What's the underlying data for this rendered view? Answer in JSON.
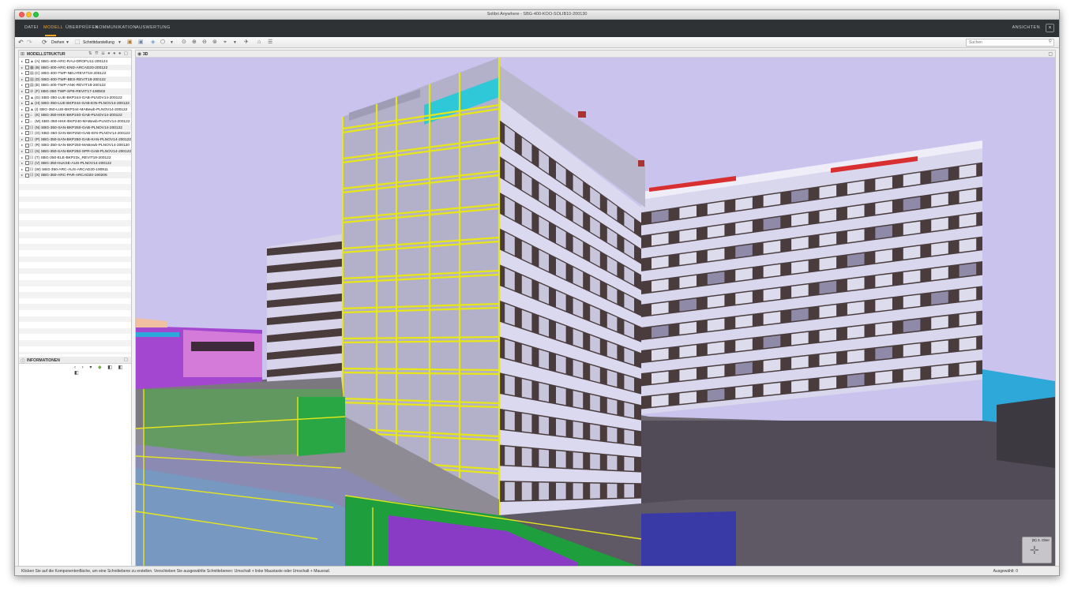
{
  "window": {
    "title": "Solibri Anywhere - SBG-400-KOO-SOLIB10-200130"
  },
  "menu": {
    "items": [
      "DATEI",
      "MODELL",
      "ÜBERPRÜFEN",
      "KOMMUNIKATION",
      "AUSWERTUNG"
    ],
    "active": "MODELL",
    "right": "ANSICHTEN"
  },
  "toolbar": {
    "rotate_label": "Drehen",
    "section_label": "Schnittdarstellung",
    "search_placeholder": "Suchen"
  },
  "model_tree": {
    "title": "MODELLSTRUKTUR",
    "items": [
      "(A) SBG-400-ARC-RAU-DROFU11-200124",
      "(B) SBG-400-ARC-END-ARCAD20-200122",
      "(C) SBG-400-TWP-NEU-REVIT18-200122",
      "(D) SBG-400-TWP-BES-REVIT18-200122",
      "(E) SBG-400-TWP-ANK-REVIT18-200122",
      "(F) SBG-350-TWP-SPE-REVIT17-190502",
      "(G) SBG-350-LUE-BKP244-GAB-PLNOV14-200122",
      "(H) SBG-350-LUE-BKP244-GAB-EIN-PLNOV14-200122",
      "(I) SBG-350-LUE-BKP244-MABewb-PLNOV14-200122",
      "(K) SBG-350-HKK-BKP240-GAB-PLNOV14-200122",
      "(M) SBG-350-HKK-BKP240-MABewb-PLNOV14-200122",
      "(N) SBG-350-SAN-BKP250-GAB-PLNOV14-200122",
      "(O) SBG-350-SAN-BKP250-GAB-EIN-PLNOV14-200122",
      "(P) SBG-350-SAN-BKP250-GAB-KAN-PLNOV14-200122",
      "(R) SBG-350-SAN-BKP250-MABewb-PLNOV14-200120",
      "(S) SBG-350-SAN-BKP250-SPR-GAB-PLNOV14-200122",
      "(T) SBG-350-ELE-BKP23x_REVIT19-200122",
      "(V) SBG-350-HLKSE-AUS-PLNOV14-200122",
      "(W) SBG-350-ARC-AUS-ARCAD20-190911",
      "(X) SBG-350-ARC-PAR-ARCAD20-190206"
    ]
  },
  "info_panel": {
    "title": "INFORMATIONEN"
  },
  "view3d": {
    "title": "3D",
    "navcube_label": "(B) 3. Ober"
  },
  "status": {
    "message": "Klicken Sie auf die Komponentenfläche, um eine Schnittebene zu erstellen. Verschieben Sie ausgewählte Schnittebenen: Umschalt + linke Maustaste oder Umschalt + Mausrad.",
    "selected": "Ausgewählt: 0"
  },
  "colors": {
    "menubar": "#2e3235",
    "accent": "#f5a623",
    "sky": "#c9c3ed",
    "facade": "#d9d7ee",
    "window_band": "#4a3c3c",
    "section_yellow": "#e6e619",
    "ground": "#5b5560"
  },
  "icons": [
    "undo-icon",
    "redo-icon",
    "rotate-icon",
    "section-icon",
    "zoom-in-icon",
    "zoom-out-icon",
    "search-icon",
    "home-icon",
    "layers-icon"
  ]
}
